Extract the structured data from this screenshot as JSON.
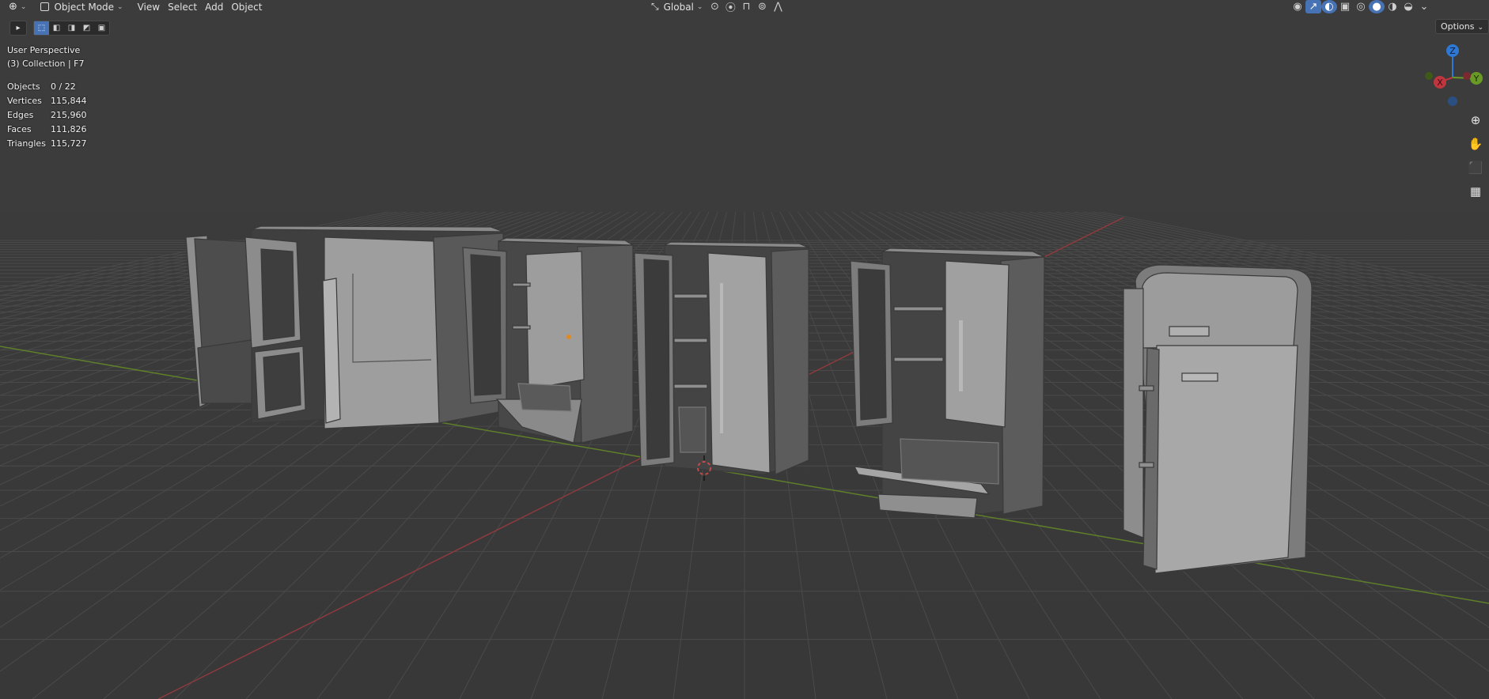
{
  "header": {
    "editor_icon": "3d-viewport-icon",
    "mode": "Object Mode",
    "menus": [
      "View",
      "Select",
      "Add",
      "Object"
    ],
    "orientation": "Global"
  },
  "overlay": {
    "view_name": "User Perspective",
    "collection": "(3) Collection | F7"
  },
  "stats": [
    {
      "label": "Objects",
      "value": "0 / 22"
    },
    {
      "label": "Vertices",
      "value": "115,844"
    },
    {
      "label": "Edges",
      "value": "215,960"
    },
    {
      "label": "Faces",
      "value": "111,826"
    },
    {
      "label": "Triangles",
      "value": "115,727"
    }
  ],
  "options_label": "Options",
  "gizmo": {
    "x": "X",
    "y": "Y",
    "z": "Z"
  },
  "nav_icons": [
    "zoom-icon",
    "hand-pan-icon",
    "camera-icon",
    "ortho-grid-icon"
  ],
  "colors": {
    "background": "#3d3d3d",
    "x_axis": "#c0363f",
    "y_axis": "#6a9a26",
    "z_axis": "#2e78d4",
    "accent": "#4772b3",
    "model": "#a9a9a9"
  }
}
